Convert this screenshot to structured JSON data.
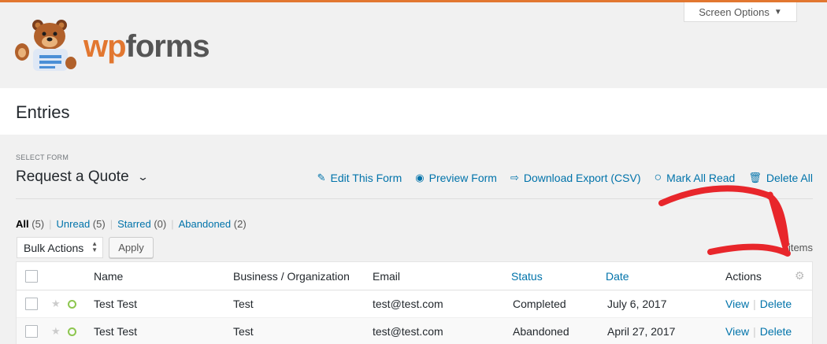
{
  "header": {
    "screen_options": "Screen Options",
    "logo_wp": "wp",
    "logo_forms": "forms"
  },
  "page": {
    "title": "Entries"
  },
  "form_selector": {
    "label": "SELECT FORM",
    "value": "Request a Quote"
  },
  "toolbar": {
    "edit": "Edit This Form",
    "preview": "Preview Form",
    "export": "Download Export (CSV)",
    "mark_read": "Mark All Read",
    "delete_all": "Delete All"
  },
  "filters": {
    "all": "All",
    "all_count": "(5)",
    "unread": "Unread",
    "unread_count": "(5)",
    "starred": "Starred",
    "starred_count": "(0)",
    "abandoned": "Abandoned",
    "abandoned_count": "(2)",
    "sep": "|"
  },
  "bulk": {
    "select_value": "Bulk Actions",
    "apply": "Apply",
    "items_count": "items"
  },
  "table": {
    "columns": {
      "name": "Name",
      "business": "Business / Organization",
      "email": "Email",
      "status": "Status",
      "date": "Date",
      "actions": "Actions"
    },
    "rows": [
      {
        "name": "Test Test",
        "business": "Test",
        "email": "test@test.com",
        "status": "Completed",
        "date": "July 6, 2017",
        "view": "View",
        "delete": "Delete"
      },
      {
        "name": "Test Test",
        "business": "Test",
        "email": "test@test.com",
        "status": "Abandoned",
        "date": "April 27, 2017",
        "view": "View",
        "delete": "Delete"
      }
    ],
    "action_sep": "|"
  },
  "colors": {
    "accent": "#e27730",
    "link": "#0073aa",
    "annotation": "#e8262b",
    "unread_indicator": "#8dc64f"
  }
}
